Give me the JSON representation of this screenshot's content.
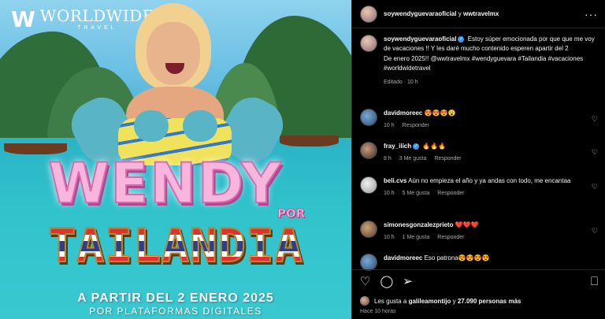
{
  "image": {
    "brand_name": "WORLDWIDE",
    "brand_sub": "TRAVEL",
    "title_main": "WENDY",
    "title_por": "POR",
    "title_country": "TAILANDIA",
    "date_line": "A PARTIR DEL 2 ENERO 2025",
    "platform_line": "POR PLATAFORMAS DIGITALES"
  },
  "header": {
    "user": "soywendyguevaraoficial",
    "connector": " y ",
    "collaborator": "wwtravelmx",
    "more_icon": "more-horizontal-icon"
  },
  "caption": {
    "username": "soywendyguevaraoficial",
    "text_line1": "Estoy súper emocionada por que que me voy de vacaciones !! Y les daré mucho contenido esperen apartir del 2",
    "text_line2": "De enero 2025!! @wwtravelmx #wendyguevara #Tailandia #vacaciones #worldwidetravel",
    "meta": "Editado · 10 h"
  },
  "comments": [
    {
      "username": "davidmoreec",
      "text": "😍😍😍😮",
      "time": "10 h",
      "likes": "",
      "reply": "Responder"
    },
    {
      "username": "fray_ilich",
      "verified": true,
      "text": "🔥🔥🔥",
      "time": "8 h",
      "likes": "3 Me gusta",
      "reply": "Responder"
    },
    {
      "username": "beli.cvs",
      "text": "Aún no empieza el año y ya andas con todo, me encantaa",
      "time": "10 h",
      "likes": "5 Me gusta",
      "reply": "Responder"
    },
    {
      "username": "simonesgonzalezprieto",
      "text": "❤️❤️❤️",
      "time": "10 h",
      "likes": "1 Me gusta",
      "reply": "Responder"
    },
    {
      "username": "davidmoreec",
      "text": "Eso patrona😍😍😍😍",
      "time": "",
      "likes": "",
      "reply": ""
    }
  ],
  "likes": {
    "prefix": "Les gusta a ",
    "user": "galileamontijo",
    "middle": " y ",
    "count": "27.090 personas más"
  },
  "timestamp": "Hace 10 horas"
}
